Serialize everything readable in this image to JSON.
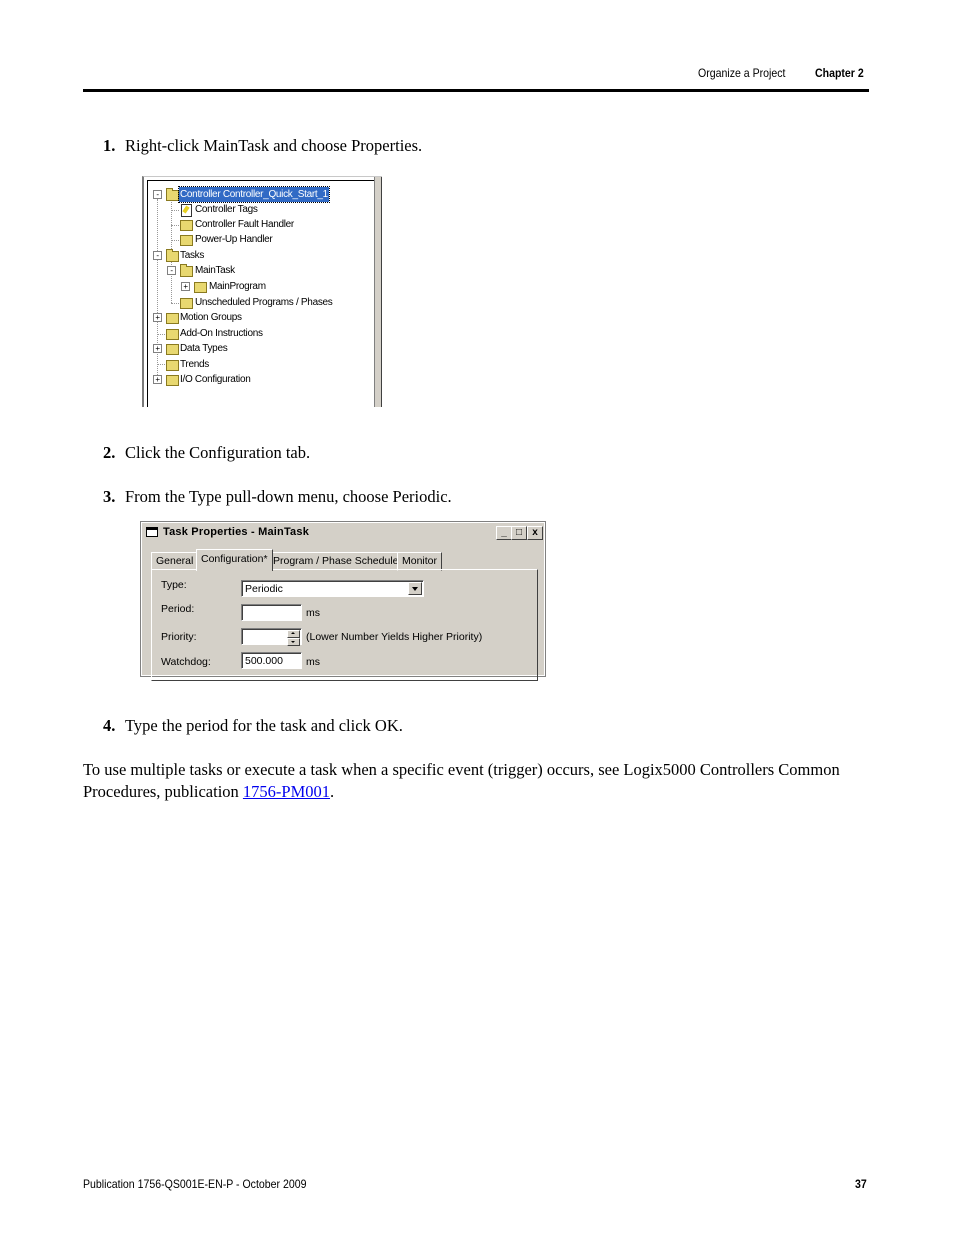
{
  "header": {
    "section": "Organize a Project",
    "chapter": "Chapter 2"
  },
  "steps": [
    {
      "num": "1.",
      "text": "Right-click MainTask and choose Properties."
    },
    {
      "num": "2.",
      "text": "Click the Configuration tab."
    },
    {
      "num": "3.",
      "text": "From the Type pull-down menu, choose Periodic."
    },
    {
      "num": "4.",
      "text": "Type the period for the task and click OK."
    }
  ],
  "tree": {
    "items": [
      {
        "label": "Controller Controller_Quick_Start_1",
        "expander": "-",
        "icon": "folder-open-icon",
        "selected": true
      },
      {
        "label": "Controller Tags",
        "expander": "",
        "icon": "tags-icon"
      },
      {
        "label": "Controller Fault Handler",
        "expander": "",
        "icon": "folder-icon"
      },
      {
        "label": "Power-Up Handler",
        "expander": "",
        "icon": "folder-icon"
      },
      {
        "label": "Tasks",
        "expander": "-",
        "icon": "folder-open-icon"
      },
      {
        "label": "MainTask",
        "expander": "-",
        "icon": "task-icon"
      },
      {
        "label": "MainProgram",
        "expander": "+",
        "icon": "program-icon"
      },
      {
        "label": "Unscheduled Programs / Phases",
        "expander": "",
        "icon": "folder-icon"
      },
      {
        "label": "Motion Groups",
        "expander": "+",
        "icon": "folder-icon"
      },
      {
        "label": "Add-On Instructions",
        "expander": "",
        "icon": "folder-icon"
      },
      {
        "label": "Data Types",
        "expander": "+",
        "icon": "folder-icon"
      },
      {
        "label": "Trends",
        "expander": "",
        "icon": "folder-icon"
      },
      {
        "label": "I/O Configuration",
        "expander": "+",
        "icon": "folder-icon"
      }
    ]
  },
  "dialog": {
    "title": "Task Properties - MainTask",
    "window_buttons": {
      "minimize": "_",
      "maximize": "□",
      "close": "x"
    },
    "tabs": [
      {
        "label": "General",
        "active": false
      },
      {
        "label": "Configuration*",
        "active": true
      },
      {
        "label": "Program / Phase Schedule",
        "active": false
      },
      {
        "label": "Monitor",
        "active": false
      }
    ],
    "fields": {
      "type_label": "Type:",
      "type_value": "Periodic",
      "period_label": "Period:",
      "period_value": "",
      "period_unit": "ms",
      "priority_label": "Priority:",
      "priority_value": "",
      "priority_note": "(Lower Number Yields Higher Priority)",
      "watchdog_label": "Watchdog:",
      "watchdog_value": "500.000",
      "watchdog_unit": "ms"
    }
  },
  "paragraph": {
    "text": "To use multiple tasks or execute a task when a specific event (trigger) occurs, see Logix5000 Controllers Common Procedures, publication ",
    "link": "1756-PM001",
    "suffix": "."
  },
  "footer": {
    "publication": "Publication 1756-QS001E-EN-P - October 2009",
    "page": "37"
  }
}
